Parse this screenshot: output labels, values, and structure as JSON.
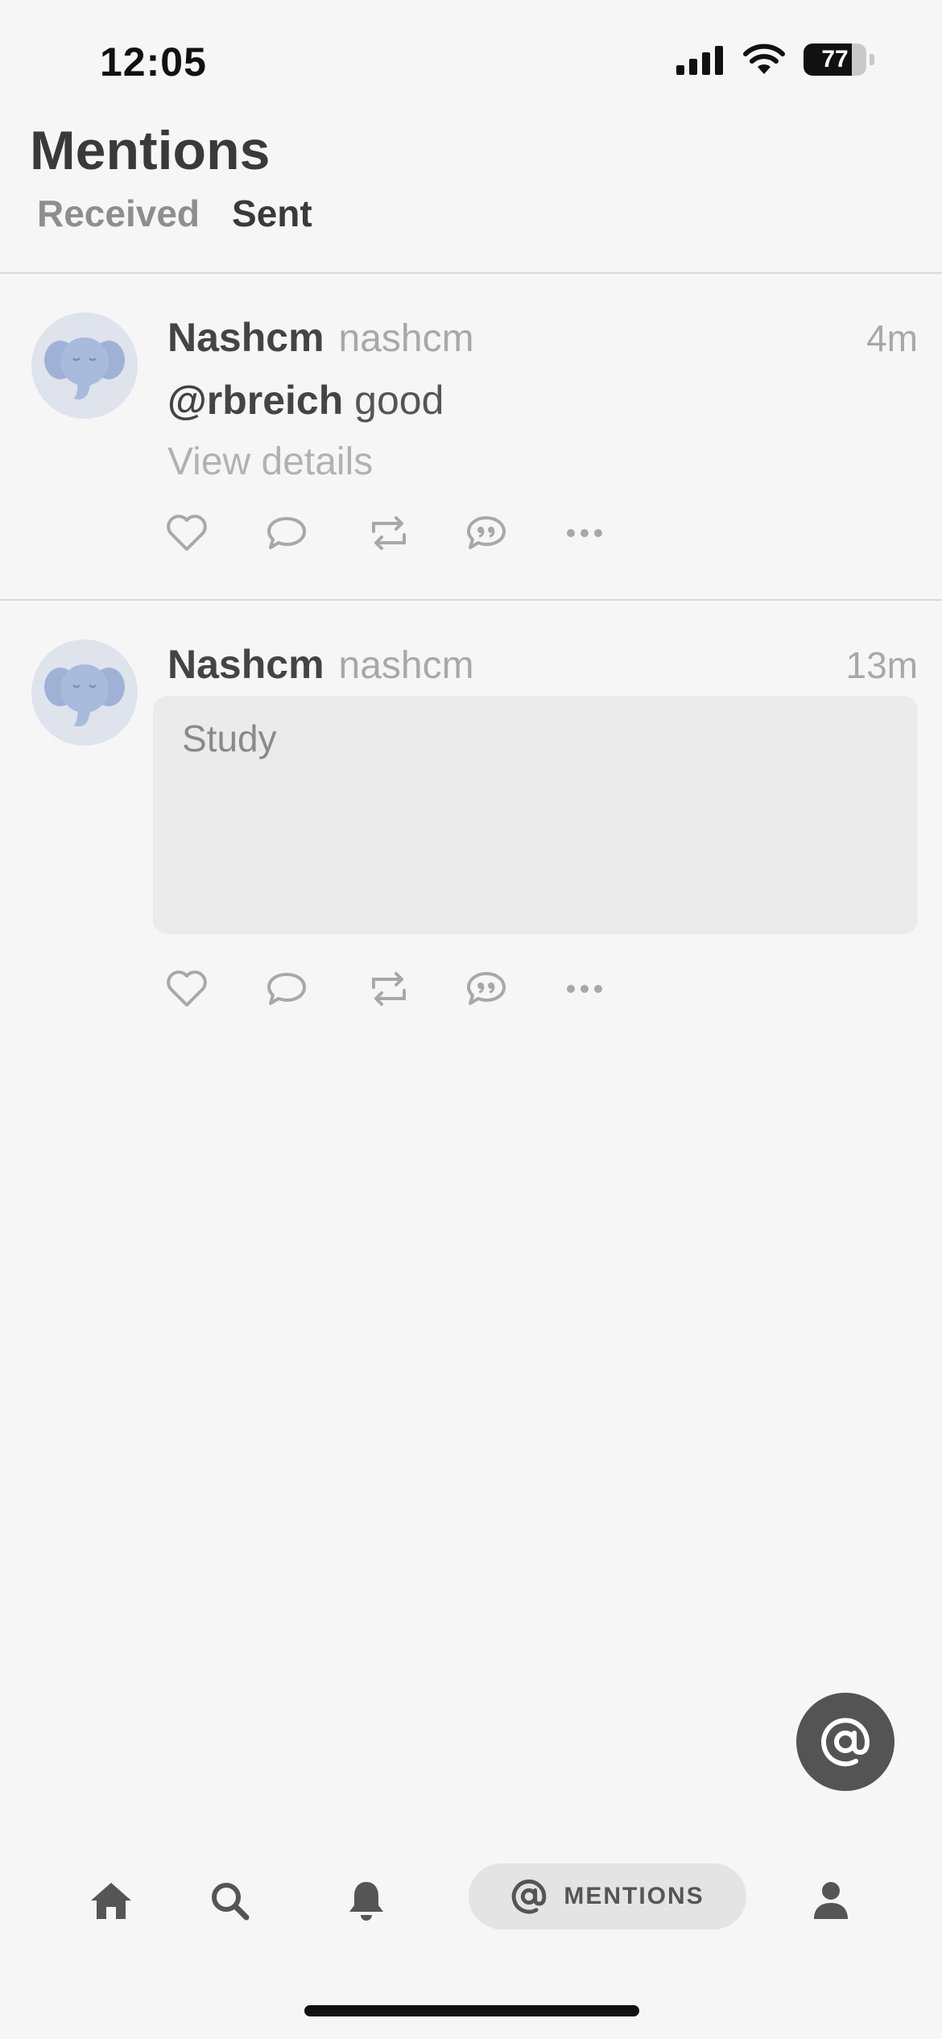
{
  "status_bar": {
    "time": "12:05",
    "battery": "77",
    "battery_level": 0.77
  },
  "header": {
    "title": "Mentions",
    "tabs": [
      {
        "label": "Received",
        "active": false
      },
      {
        "label": "Sent",
        "active": true
      }
    ]
  },
  "posts": [
    {
      "display_name": "Nashcm",
      "handle": "nashcm",
      "time": "4m",
      "mention": "@rbreich",
      "text": "good",
      "view_details": "View details"
    },
    {
      "display_name": "Nashcm",
      "handle": "nashcm",
      "time": "13m",
      "card_text": "Study"
    }
  ],
  "tabbar": {
    "active_label": "MENTIONS"
  },
  "colors": {
    "accent": "#545454",
    "avatar_bg": "#dfe4ec",
    "elephant": "#9fb1d4"
  }
}
